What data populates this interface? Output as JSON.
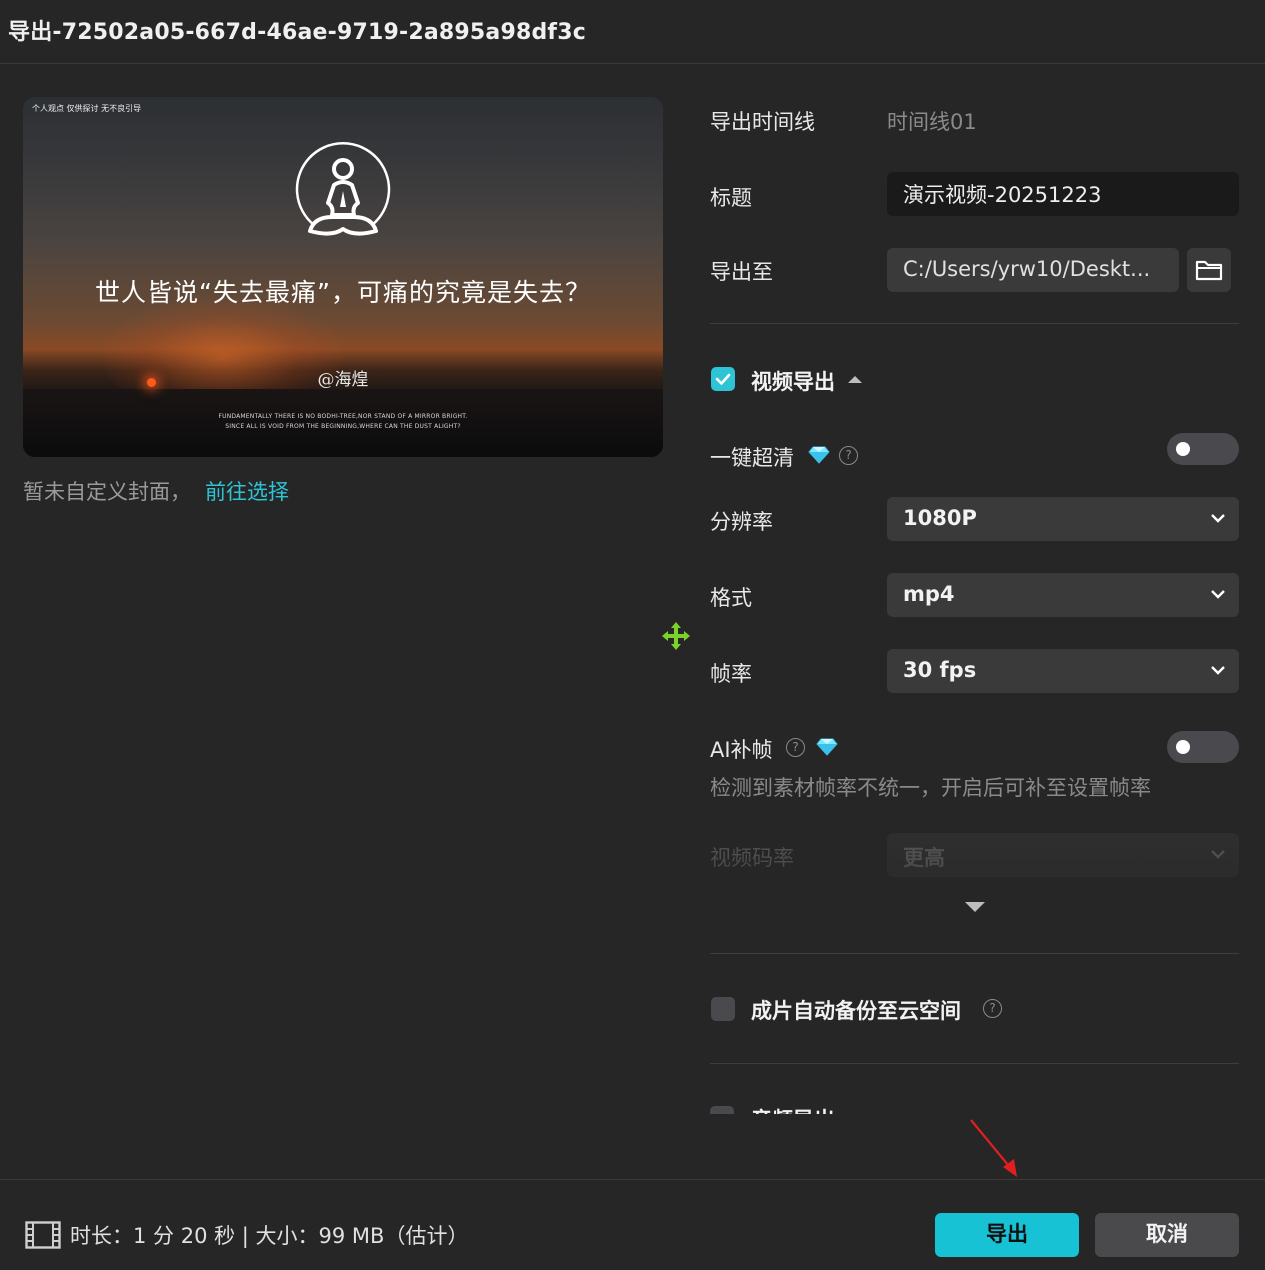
{
  "window": {
    "title": "导出-72502a05-667d-46ae-9719-2a895a98df3c"
  },
  "preview": {
    "corner_text": "个人观点 仅供探讨 无不良引导",
    "caption": "世人皆说“失去最痛”，可痛的究竟是失去？",
    "handle": "@海煌",
    "quote_line1": "FUNDAMENTALLY THERE IS NO BODHI-TREE,NOR STAND OF A MIRROR BRIGHT.",
    "quote_line2": "SINCE ALL IS VOID FROM THE BEGINNING,WHERE CAN THE DUST ALIGHT?"
  },
  "cover": {
    "note": "暂未自定义封面，",
    "link": "前往选择"
  },
  "form": {
    "timeline_label": "导出时间线",
    "timeline_value": "时间线01",
    "title_label": "标题",
    "title_value": "演示视频-20251223",
    "export_to_label": "导出至",
    "export_path": "C:/Users/yrw10/Deskt..."
  },
  "video_export": {
    "section_label": "视频导出",
    "checked": true,
    "super_clear_label": "一键超清",
    "super_clear_on": false,
    "resolution_label": "分辨率",
    "resolution_value": "1080P",
    "format_label": "格式",
    "format_value": "mp4",
    "framerate_label": "帧率",
    "framerate_value": "30 fps",
    "ai_frame_label": "AI补帧",
    "ai_frame_on": false,
    "ai_frame_hint": "检测到素材帧率不统一，开启后可补至设置帧率",
    "bitrate_label": "视频码率",
    "bitrate_value": "更高"
  },
  "cloud_backup": {
    "label": "成片自动备份至云空间",
    "checked": false
  },
  "audio_export": {
    "label": "音频导出"
  },
  "footer": {
    "info": "时长：1 分 20 秒 | 大小：99 MB（估计）",
    "export_button": "导出",
    "cancel_button": "取消"
  },
  "colors": {
    "accent": "#16c2d4",
    "background": "#262626",
    "field": "#3a3a3a",
    "annotation_arrow": "#e02020",
    "move_cursor": "#7ad12a"
  },
  "icons": [
    "folder-icon",
    "chevron-down-icon",
    "chevron-up-icon",
    "diamond-icon",
    "help-icon",
    "film-icon",
    "move-icon",
    "meditation-logo-icon"
  ]
}
